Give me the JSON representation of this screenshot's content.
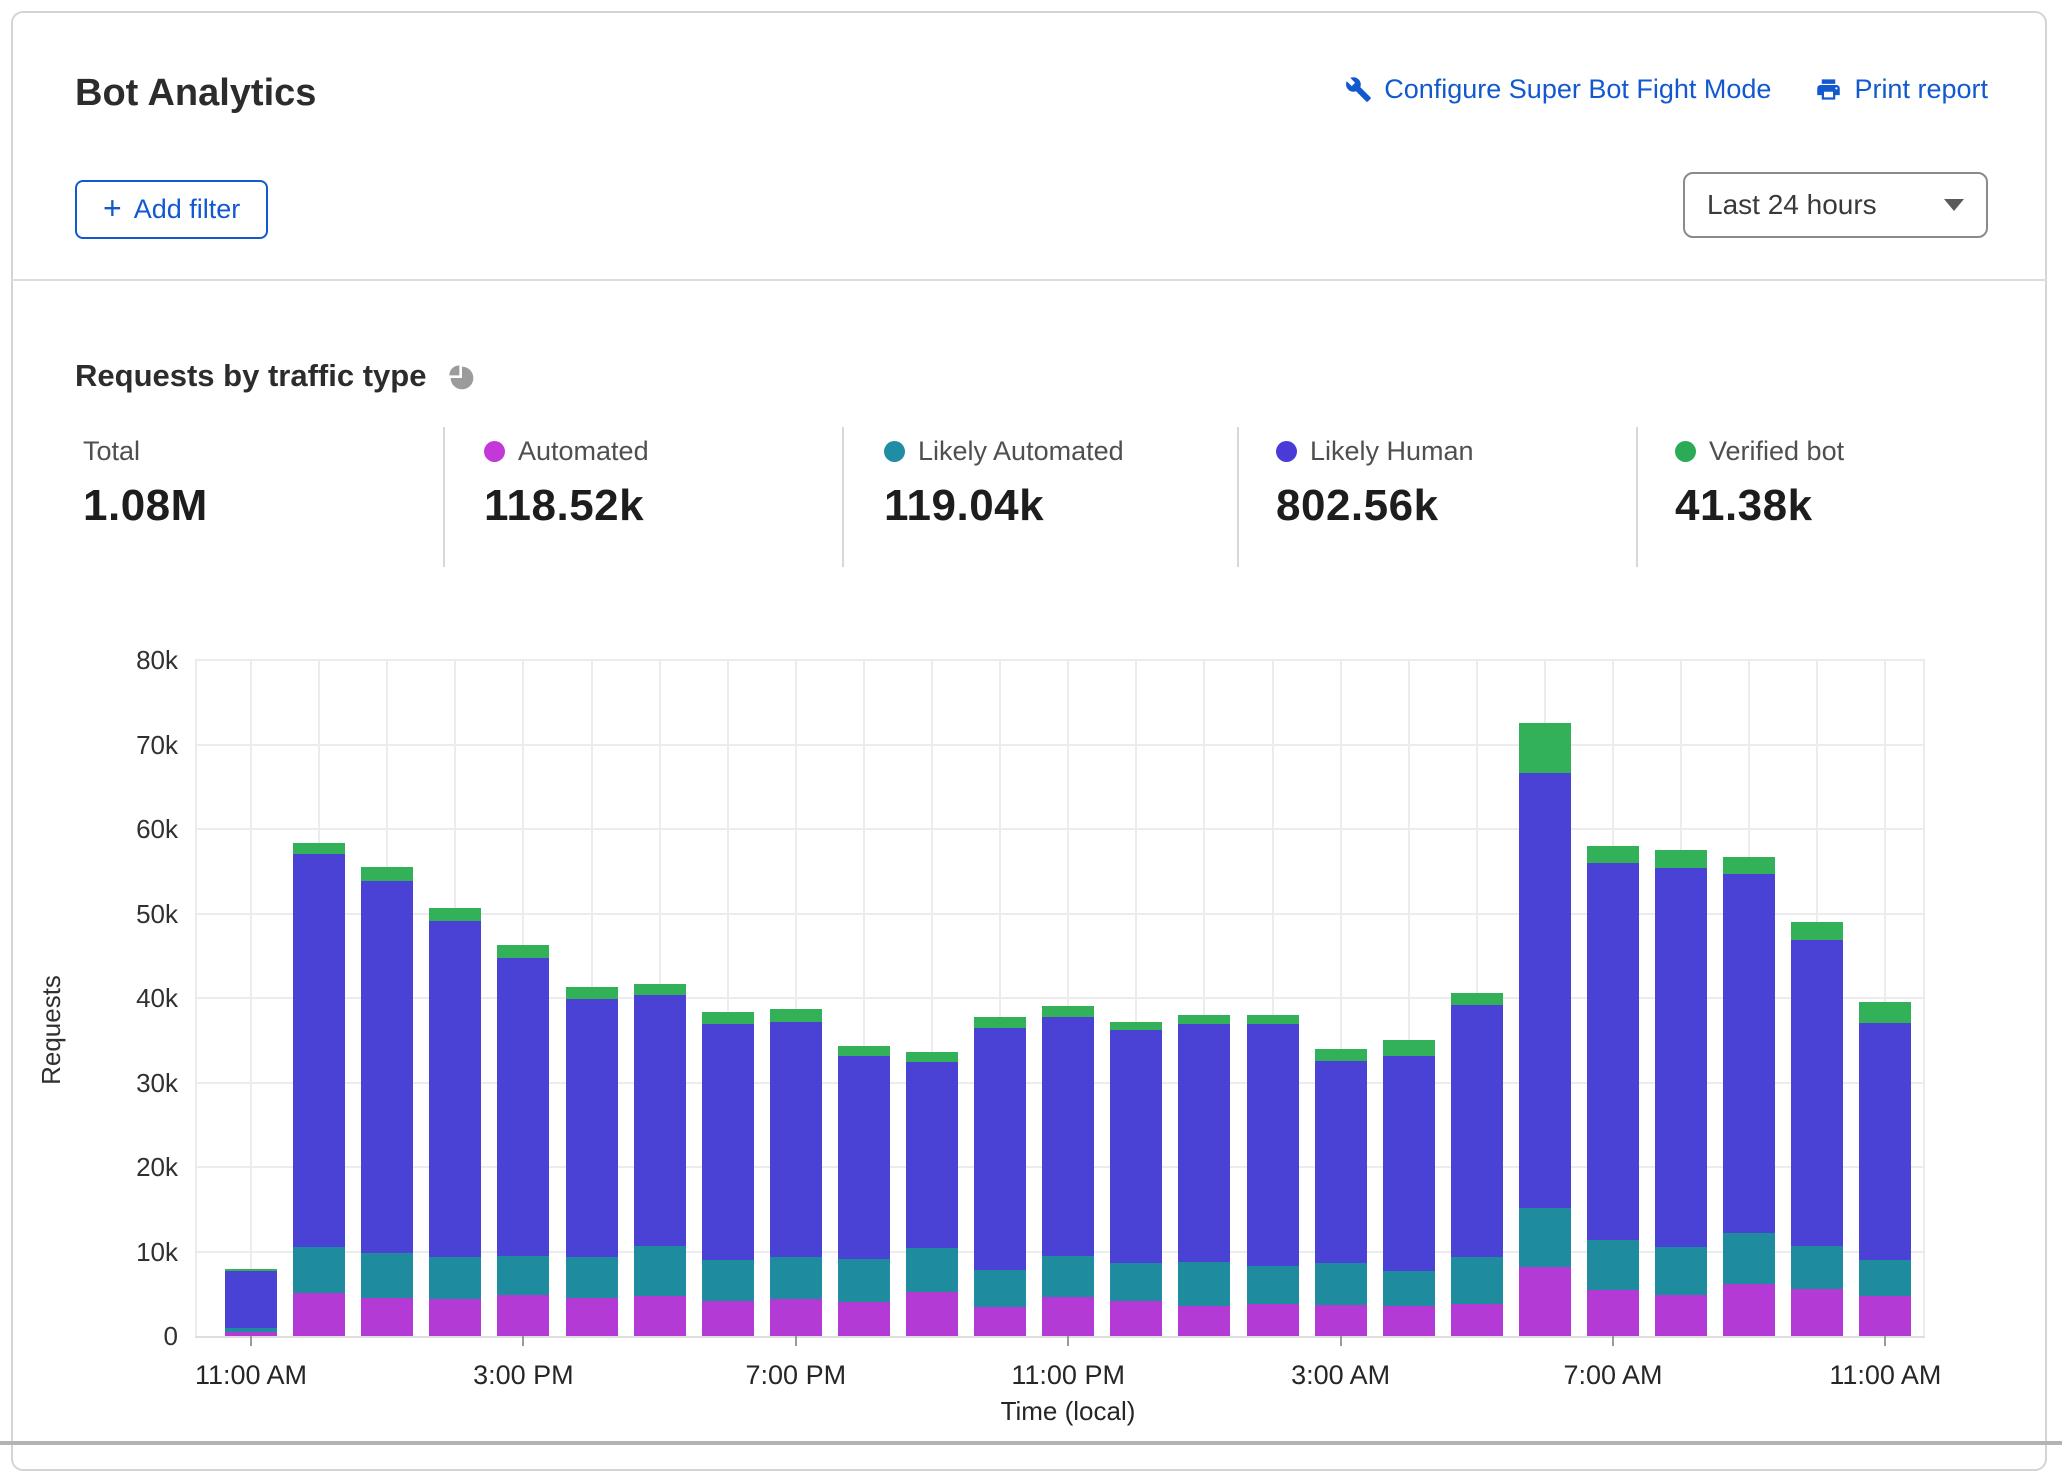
{
  "header": {
    "title": "Bot Analytics",
    "configure_link": "Configure Super Bot Fight Mode",
    "print_link": "Print report",
    "add_filter_label": "Add filter",
    "time_range_value": "Last 24 hours"
  },
  "section": {
    "heading": "Requests by traffic type"
  },
  "stats": [
    {
      "label": "Total",
      "value": "1.08M"
    },
    {
      "label": "Automated",
      "value": "118.52k",
      "dot": "#c238d8"
    },
    {
      "label": "Likely Automated",
      "value": "119.04k",
      "dot": "#1f8da3"
    },
    {
      "label": "Likely Human",
      "value": "802.56k",
      "dot": "#4a3bd8"
    },
    {
      "label": "Verified bot",
      "value": "41.38k",
      "dot": "#2bab55"
    }
  ],
  "chart_data": {
    "type": "bar",
    "stacked": true,
    "title": "Requests by traffic type",
    "xlabel": "Time (local)",
    "ylabel": "Requests",
    "ylim": [
      0,
      80000
    ],
    "grid": true,
    "y_tick_labels": [
      "0",
      "10k",
      "20k",
      "30k",
      "40k",
      "50k",
      "60k",
      "70k",
      "80k"
    ],
    "x": [
      "11:00 AM",
      "12:00 PM",
      "1:00 PM",
      "2:00 PM",
      "3:00 PM",
      "4:00 PM",
      "5:00 PM",
      "6:00 PM",
      "7:00 PM",
      "8:00 PM",
      "9:00 PM",
      "10:00 PM",
      "11:00 PM",
      "12:00 AM",
      "1:00 AM",
      "2:00 AM",
      "3:00 AM",
      "4:00 AM",
      "5:00 AM",
      "6:00 AM",
      "7:00 AM",
      "8:00 AM",
      "9:00 AM",
      "10:00 AM",
      "11:00 AM"
    ],
    "x_tick_indices": [
      0,
      4,
      8,
      12,
      16,
      20,
      24
    ],
    "x_tick_labels": [
      "11:00 AM",
      "3:00 PM",
      "7:00 PM",
      "11:00 PM",
      "3:00 AM",
      "7:00 AM",
      "11:00 AM"
    ],
    "series": [
      {
        "name": "Automated",
        "color": "#b43ad6",
        "values": [
          500,
          5100,
          4500,
          4400,
          4800,
          4500,
          4700,
          4200,
          4400,
          4000,
          5200,
          3400,
          4600,
          4200,
          3600,
          3800,
          3700,
          3500,
          3800,
          8200,
          5400,
          4900,
          6200,
          5600,
          4700
        ]
      },
      {
        "name": "Likely Automated",
        "color": "#1f8b9e",
        "values": [
          500,
          5400,
          5300,
          5000,
          4700,
          4800,
          6000,
          4800,
          4900,
          5100,
          5200,
          4400,
          4900,
          4400,
          5200,
          4500,
          4900,
          4200,
          5600,
          6900,
          6000,
          5600,
          6000,
          5100,
          4300
        ]
      },
      {
        "name": "Likely Human",
        "color": "#4a42d4",
        "values": [
          6700,
          46500,
          44000,
          39700,
          35200,
          30600,
          29700,
          27900,
          27900,
          24000,
          22000,
          28600,
          28300,
          27600,
          28100,
          28600,
          23900,
          25400,
          29800,
          51500,
          44600,
          44900,
          42500,
          36200,
          28100
        ]
      },
      {
        "name": "Verified bot",
        "color": "#33b158",
        "values": [
          200,
          1400,
          1700,
          1600,
          1600,
          1400,
          1300,
          1400,
          1500,
          1200,
          1200,
          1400,
          1300,
          1000,
          1100,
          1100,
          1500,
          1900,
          1400,
          5900,
          2000,
          2100,
          2000,
          2100,
          2400
        ]
      }
    ]
  }
}
